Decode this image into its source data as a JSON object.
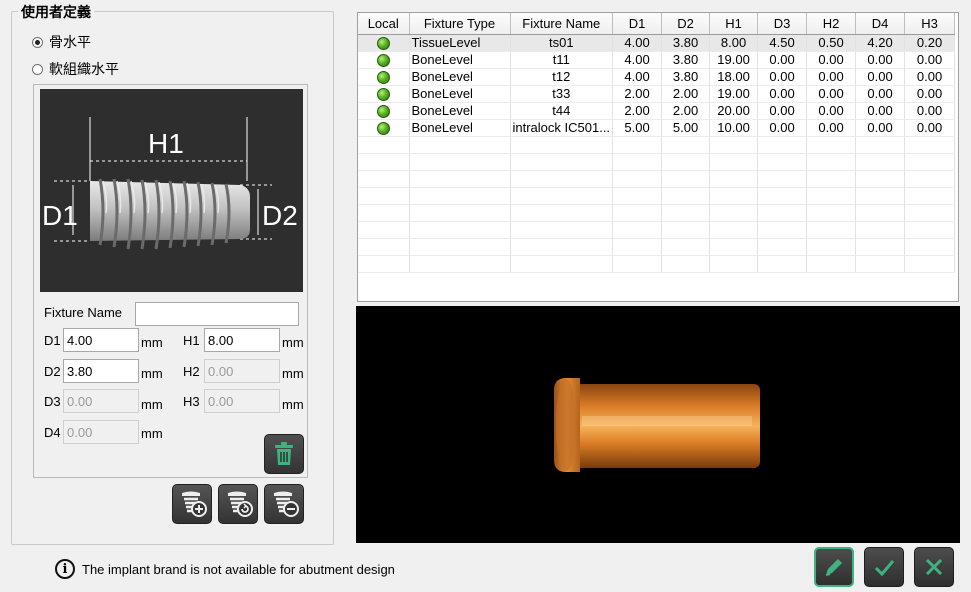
{
  "definition": {
    "group_title": "使用者定義",
    "radio_bone": "骨水平",
    "radio_tissue": "軟組織水平",
    "selected_radio": "bone",
    "diagram": {
      "h1": "H1",
      "d1": "D1",
      "d2": "D2"
    },
    "fields": {
      "name_label": "Fixture Name",
      "name_value": "",
      "d1_label": "D1",
      "d1_value": "4.00",
      "d2_label": "D2",
      "d2_value": "3.80",
      "d3_label": "D3",
      "d3_value": "0.00",
      "d4_label": "D4",
      "d4_value": "0.00",
      "h1_label": "H1",
      "h1_value": "8.00",
      "h2_label": "H2",
      "h2_value": "0.00",
      "h3_label": "H3",
      "h3_value": "0.00",
      "unit": "mm"
    },
    "buttons": [
      "trash-icon",
      "add-fixture-icon",
      "refresh-fixture-icon",
      "remove-fixture-icon"
    ]
  },
  "table": {
    "columns": [
      "Local",
      "Fixture Type",
      "Fixture Name",
      "D1",
      "D2",
      "H1",
      "D3",
      "H2",
      "D4",
      "H3"
    ],
    "rows": [
      {
        "local": true,
        "type": "TissueLevel",
        "name": "ts01",
        "d1": "4.00",
        "d2": "3.80",
        "h1": "8.00",
        "d3": "4.50",
        "h2": "0.50",
        "d4": "4.20",
        "h3": "0.20",
        "selected": true
      },
      {
        "local": true,
        "type": "BoneLevel",
        "name": "t11",
        "d1": "4.00",
        "d2": "3.80",
        "h1": "19.00",
        "d3": "0.00",
        "h2": "0.00",
        "d4": "0.00",
        "h3": "0.00",
        "selected": false
      },
      {
        "local": true,
        "type": "BoneLevel",
        "name": "t12",
        "d1": "4.00",
        "d2": "3.80",
        "h1": "18.00",
        "d3": "0.00",
        "h2": "0.00",
        "d4": "0.00",
        "h3": "0.00",
        "selected": false
      },
      {
        "local": true,
        "type": "BoneLevel",
        "name": "t33",
        "d1": "2.00",
        "d2": "2.00",
        "h1": "19.00",
        "d3": "0.00",
        "h2": "0.00",
        "d4": "0.00",
        "h3": "0.00",
        "selected": false
      },
      {
        "local": true,
        "type": "BoneLevel",
        "name": "t44",
        "d1": "2.00",
        "d2": "2.00",
        "h1": "20.00",
        "d3": "0.00",
        "h2": "0.00",
        "d4": "0.00",
        "h3": "0.00",
        "selected": false
      },
      {
        "local": true,
        "type": "BoneLevel",
        "name": "intralock IC501...",
        "d1": "5.00",
        "d2": "5.00",
        "h1": "10.00",
        "d3": "0.00",
        "h2": "0.00",
        "d4": "0.00",
        "h3": "0.00",
        "selected": false
      }
    ],
    "local_icon": "green-dot-icon"
  },
  "footer": {
    "status_text": "The implant brand is not available for abutment design",
    "status_icon": "info-icon",
    "actions": [
      "edit-icon",
      "check-icon",
      "close-icon"
    ]
  },
  "colors": {
    "accent_green": "#3fb37f",
    "viewer_bg": "#000000",
    "fixture_copper": "#e08a32"
  }
}
